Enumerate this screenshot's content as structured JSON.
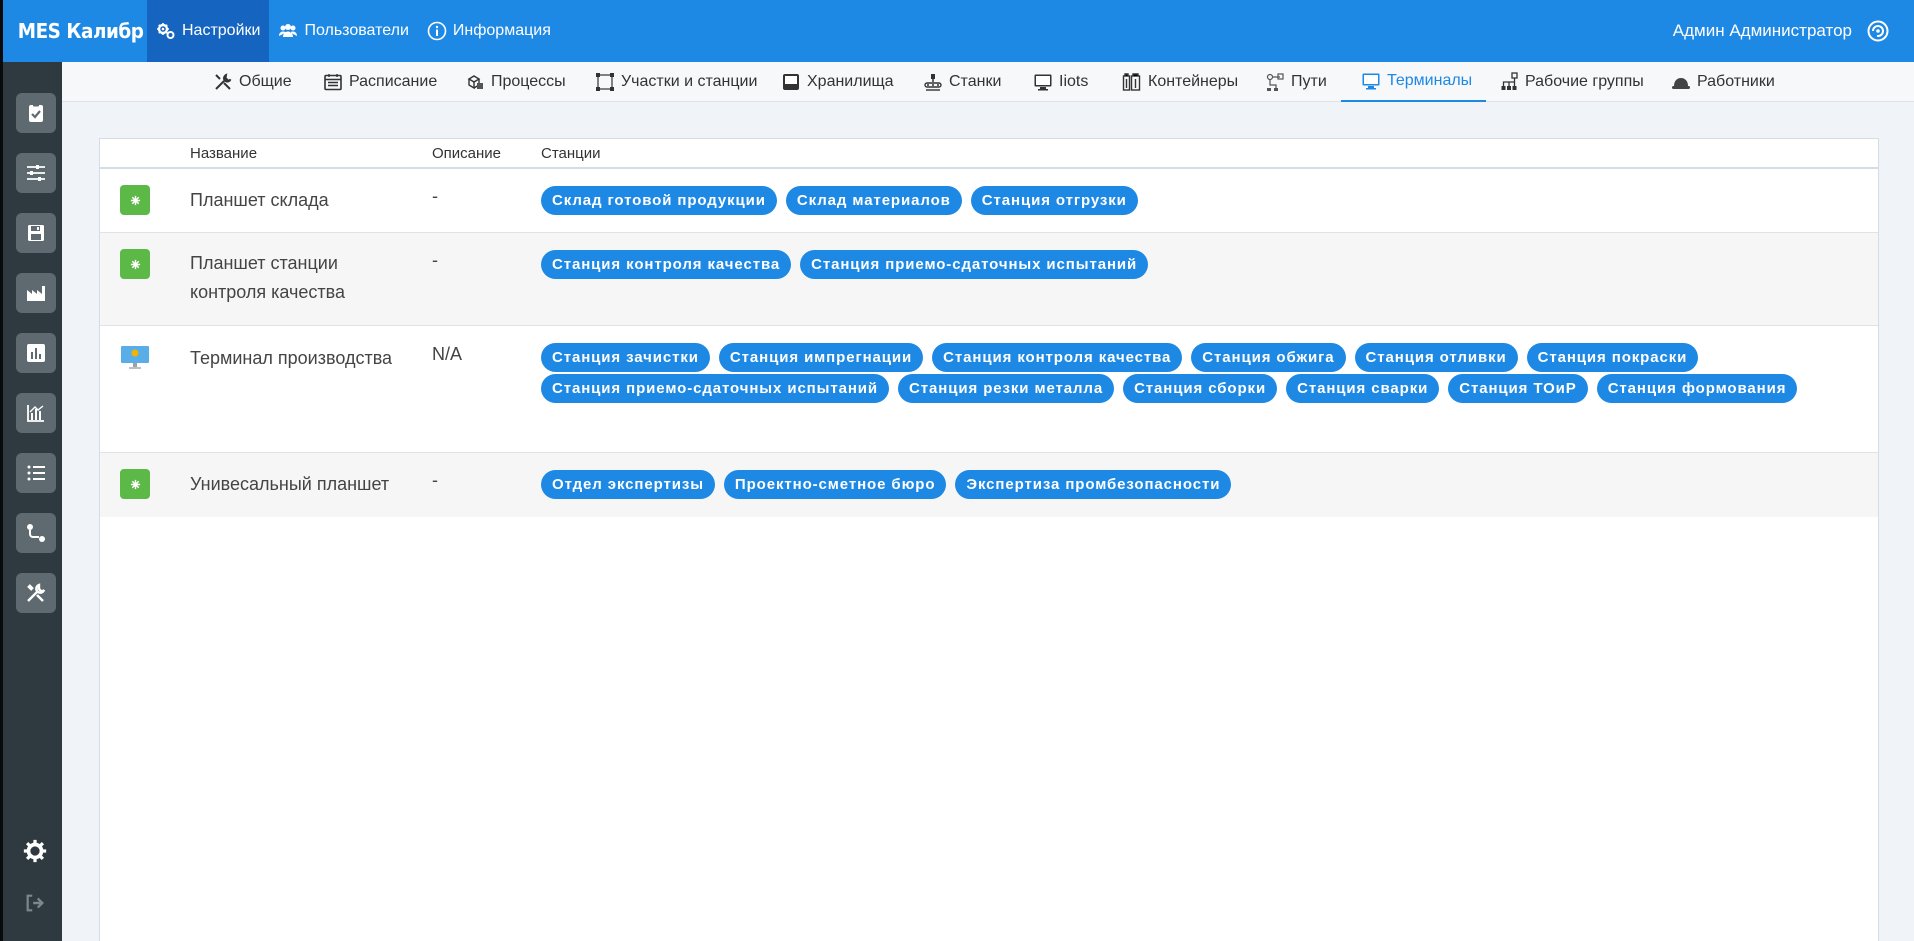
{
  "app": {
    "brand": "MES Калибр",
    "user_name": "Админ Администратор"
  },
  "topnav": [
    {
      "label": "Настройки",
      "icon": "gears-icon",
      "active": true
    },
    {
      "label": "Пользователи",
      "icon": "users-icon",
      "active": false
    },
    {
      "label": "Информация",
      "icon": "info-icon",
      "active": false
    }
  ],
  "sidebar": [
    {
      "icon": "clipboard-check-icon"
    },
    {
      "icon": "sliders-icon"
    },
    {
      "icon": "save-icon"
    },
    {
      "icon": "area-chart-icon"
    },
    {
      "icon": "bar-chart-icon"
    },
    {
      "icon": "line-chart-icon"
    },
    {
      "icon": "list-icon"
    },
    {
      "icon": "route-icon"
    },
    {
      "icon": "tools-icon"
    },
    {
      "icon": "settings-gear-icon"
    },
    {
      "icon": "sign-out-icon"
    }
  ],
  "subnav": [
    {
      "label": "Общие",
      "icon": "tools-icon"
    },
    {
      "label": "Расписание",
      "icon": "calendar-icon"
    },
    {
      "label": "Процессы",
      "icon": "cubes-icon"
    },
    {
      "label": "Участки и станции",
      "icon": "vector-square-icon"
    },
    {
      "label": "Хранилища",
      "icon": "inbox-icon"
    },
    {
      "label": "Станки",
      "icon": "conveyor-icon"
    },
    {
      "label": "Iiots",
      "icon": "desktop-icon"
    },
    {
      "label": "Контейнеры",
      "icon": "containers-icon"
    },
    {
      "label": "Пути",
      "icon": "path-icon"
    },
    {
      "label": "Терминалы",
      "icon": "monitor-icon",
      "active": true
    },
    {
      "label": "Рабочие группы",
      "icon": "sitemap-icon"
    },
    {
      "label": "Работники",
      "icon": "hard-hat-icon"
    }
  ],
  "table": {
    "headers": {
      "name": "Название",
      "description": "Описание",
      "stations": "Станции"
    },
    "rows": [
      {
        "icon": "tablet-green-icon",
        "name": "Планшет склада",
        "description": "-",
        "stations": [
          "Склад готовой продукции",
          "Склад материалов",
          "Станция отгрузки"
        ]
      },
      {
        "icon": "tablet-green-icon",
        "name": "Планшет станции контроля качества",
        "description": "-",
        "stations": [
          "Станция контроля качества",
          "Станция приемо-сдаточных испытаний"
        ]
      },
      {
        "icon": "terminal-monitor-icon",
        "name": "Терминал производства",
        "description": "N/A",
        "stations": [
          "Станция зачистки",
          "Станция импрегнации",
          "Станция контроля качества",
          "Станция обжига",
          "Станция отливки",
          "Станция покраски",
          "Станция приемо-сдаточных испытаний",
          "Станция резки металла",
          "Станция сборки",
          "Станция сварки",
          "Станция ТОиР",
          "Станция формования"
        ]
      },
      {
        "icon": "tablet-green-icon",
        "name": "Унивесальный планшет",
        "description": "-",
        "stations": [
          "Отдел экспертизы",
          "Проектно-сметное бюро",
          "Экспертиза промбезопасности"
        ]
      }
    ]
  },
  "colors": {
    "primary": "#1e88e5",
    "topbar_active": "#1565c0",
    "sidebar_bg": "#2f3a40",
    "sidebar_btn": "#5f6a70",
    "green": "#5cb847"
  }
}
